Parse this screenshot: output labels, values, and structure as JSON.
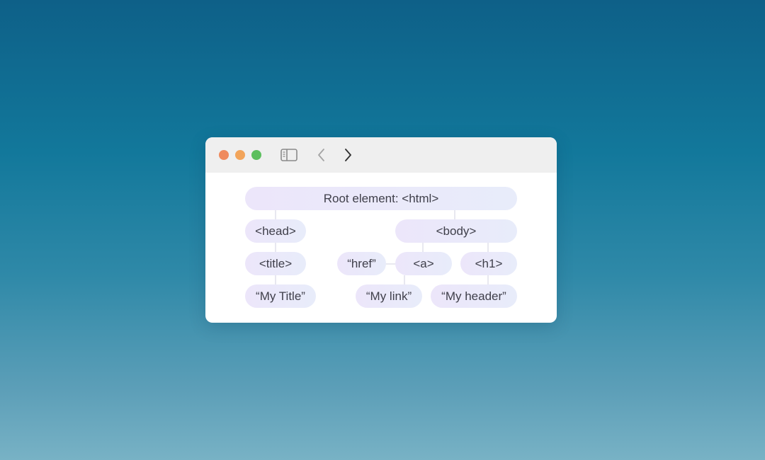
{
  "window": {
    "controls": {
      "close_color": "#ef8a5d",
      "minimize_color": "#f2a45a",
      "maximize_color": "#5cbf5e"
    },
    "toolbar": {
      "sidebar_icon": "sidebar-icon",
      "back_icon": "chevron-left-icon",
      "forward_icon": "chevron-right-icon"
    }
  },
  "tree": {
    "root": "Root element: <html>",
    "head": "<head>",
    "title": "<title>",
    "title_text": "“My Title”",
    "body": "<body>",
    "href": "“href”",
    "a": "<a>",
    "h1": "<h1>",
    "link_text": "“My link”",
    "header_text": "“My header”"
  }
}
